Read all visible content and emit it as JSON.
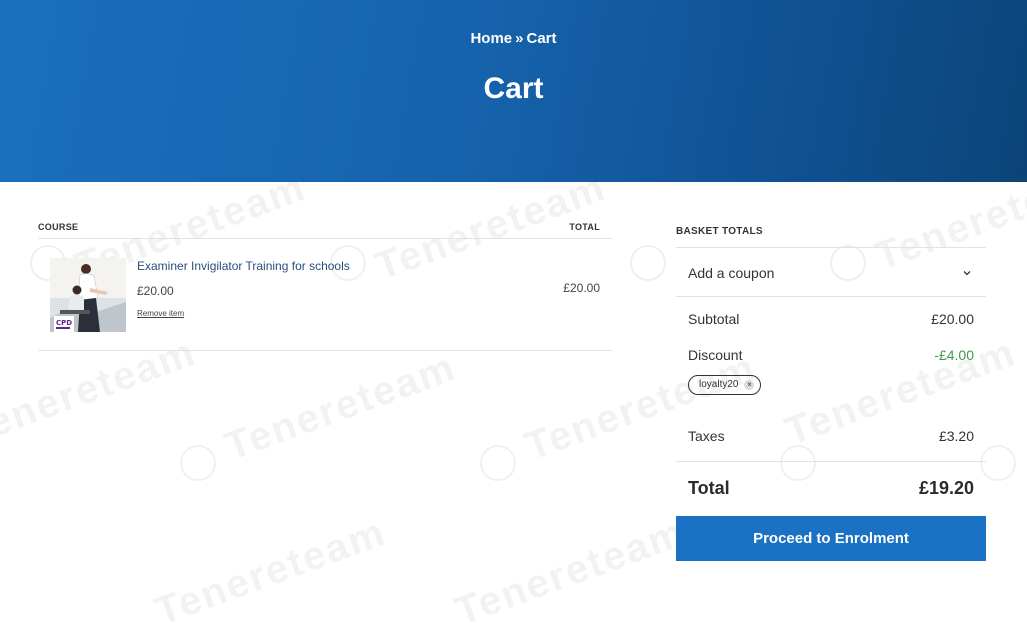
{
  "breadcrumb": {
    "home": "Home",
    "separator": "»",
    "current": "Cart"
  },
  "page_title": "Cart",
  "watermark": "Tenereteam",
  "cart": {
    "headers": {
      "course": "COURSE",
      "total": "TOTAL"
    },
    "items": [
      {
        "name": "Examiner Invigilator Training for schools",
        "price": "£20.00",
        "remove_label": "Remove item",
        "total": "£20.00"
      }
    ]
  },
  "totals": {
    "title": "BASKET TOTALS",
    "coupon_label": "Add a coupon",
    "subtotal_label": "Subtotal",
    "subtotal_value": "£20.00",
    "discount_label": "Discount",
    "discount_value": "-£4.00",
    "coupon_code": "loyalty20",
    "taxes_label": "Taxes",
    "taxes_value": "£3.20",
    "total_label": "Total",
    "total_value": "£19.20",
    "proceed_label": "Proceed to Enrolment"
  },
  "colors": {
    "hero": "#1663ad",
    "button": "#1b72c4",
    "discount": "#3d9b4a"
  }
}
